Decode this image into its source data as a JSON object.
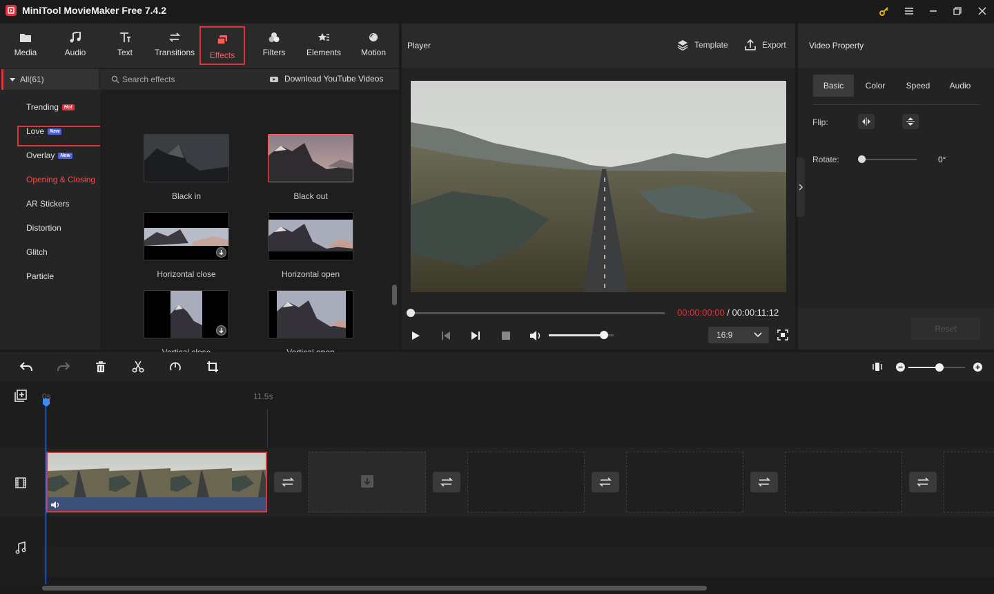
{
  "app": {
    "title": "MiniTool MovieMaker Free 7.4.2",
    "icons": [
      "key-icon",
      "menu-icon",
      "minimize-icon",
      "maximize-icon",
      "close-icon"
    ]
  },
  "toolbar": {
    "items": [
      {
        "label": "Media",
        "icon": "media-icon"
      },
      {
        "label": "Audio",
        "icon": "music-note-icon"
      },
      {
        "label": "Text",
        "icon": "text-icon"
      },
      {
        "label": "Transitions",
        "icon": "transitions-icon"
      },
      {
        "label": "Effects",
        "icon": "effects-icon",
        "active": true
      },
      {
        "label": "Filters",
        "icon": "filters-icon"
      },
      {
        "label": "Elements",
        "icon": "elements-icon"
      },
      {
        "label": "Motion",
        "icon": "motion-icon"
      }
    ]
  },
  "sidebar": {
    "all": "All(61)",
    "categories": [
      {
        "label": "Trending",
        "badge": "Hot"
      },
      {
        "label": "Love",
        "badge": "New"
      },
      {
        "label": "Overlay",
        "badge": "New"
      },
      {
        "label": "Opening & Closing",
        "selected": true
      },
      {
        "label": "AR Stickers"
      },
      {
        "label": "Distortion"
      },
      {
        "label": "Glitch"
      },
      {
        "label": "Particle"
      }
    ]
  },
  "effects": {
    "search_placeholder": "Search effects",
    "download_link": "Download YouTube Videos",
    "items": [
      {
        "label": "Black in"
      },
      {
        "label": "Black out",
        "selected": true
      },
      {
        "label": "Horizontal close",
        "download": true
      },
      {
        "label": "Horizontal open"
      },
      {
        "label": "Vertical close",
        "download": true
      },
      {
        "label": "Vertical open"
      }
    ]
  },
  "player": {
    "title": "Player",
    "template_label": "Template",
    "export_label": "Export",
    "current_time": "00:00:00:00",
    "separator": " / ",
    "total_time": "00:00:11:12",
    "aspect_ratio": "16:9",
    "progress": 0,
    "volume": 0.85
  },
  "property": {
    "title": "Video Property",
    "tabs": [
      "Basic",
      "Color",
      "Speed",
      "Audio"
    ],
    "active_tab": "Basic",
    "flip_label": "Flip:",
    "rotate_label": "Rotate:",
    "rotate_value": "0°",
    "reset_label": "Reset"
  },
  "timeline": {
    "ruler_start": "0s",
    "ruler_mark": "11.5s",
    "zoom_level": 0.55
  },
  "colors": {
    "accent": "#e0333b",
    "time_current": "#e0333b",
    "panel": "#232323",
    "header": "#2a2a2a"
  }
}
